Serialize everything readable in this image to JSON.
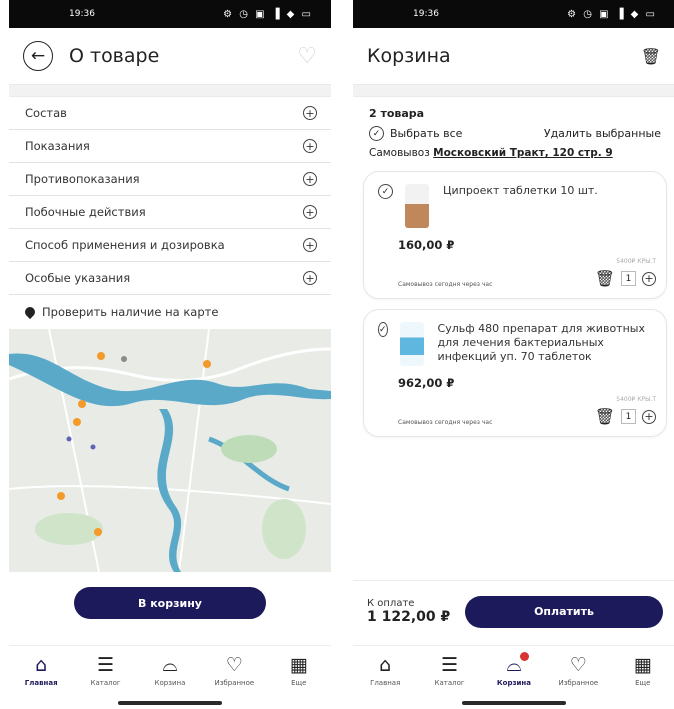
{
  "left": {
    "status": {
      "time": "19:36",
      "icons": "⚙ ◷ ▣ ▐ ◆ ▭"
    },
    "header": {
      "title": "О товаре"
    },
    "accordion": [
      {
        "label": "Состав"
      },
      {
        "label": "Показания"
      },
      {
        "label": "Противопоказания"
      },
      {
        "label": "Побочные действия"
      },
      {
        "label": "Способ применения и дозировка"
      },
      {
        "label": "Особые указания"
      }
    ],
    "map_link": "Проверить наличие на карте",
    "cart_button": "В корзину",
    "nav": [
      {
        "label": "Главная",
        "icon": "home-icon"
      },
      {
        "label": "Каталог",
        "icon": "menu-icon"
      },
      {
        "label": "Корзина",
        "icon": "bag-icon"
      },
      {
        "label": "Избранное",
        "icon": "heart-icon"
      },
      {
        "label": "Еще",
        "icon": "grid-icon"
      }
    ]
  },
  "right": {
    "status": {
      "time": "19:36",
      "icons": "⚙ ◷ ▣ ▐ ◆ ▭"
    },
    "header": {
      "title": "Корзина"
    },
    "count": "2 товара",
    "select_all": "Выбрать все",
    "delete_selected": "Удалить выбранные",
    "pickup_prefix": "Самовывоз",
    "pickup_address": "Московский Тракт, 120 стр. 9",
    "items": [
      {
        "name": "Ципроект таблетки 10 шт.",
        "price": "160,00 ₽",
        "availability": "Самовывоз сегодня через час",
        "qty_label": "5400₽ КРЫ.Т",
        "qty": "1",
        "color": "#c0875a"
      },
      {
        "name": "Сульф 480 препарат для животных для лечения бактериальных инфекций уп. 70 таблеток",
        "price": "962,00 ₽",
        "availability": "Самовывоз сегодня через час",
        "qty_label": "5400₽ КРЫ.Т",
        "qty": "1",
        "color": "#5fb6de"
      }
    ],
    "pay": {
      "label": "К оплате",
      "total": "1 122,00 ₽",
      "button": "Оплатить"
    },
    "nav": [
      {
        "label": "Главная",
        "icon": "home-icon"
      },
      {
        "label": "Каталог",
        "icon": "menu-icon"
      },
      {
        "label": "Корзина",
        "icon": "bag-icon"
      },
      {
        "label": "Избранное",
        "icon": "heart-icon"
      },
      {
        "label": "Еще",
        "icon": "grid-icon"
      }
    ]
  },
  "colors": {
    "accent": "#1d1a5c",
    "badge": "#d93333",
    "map_pin": "#f39a2b",
    "river": "#5aa9c9"
  }
}
